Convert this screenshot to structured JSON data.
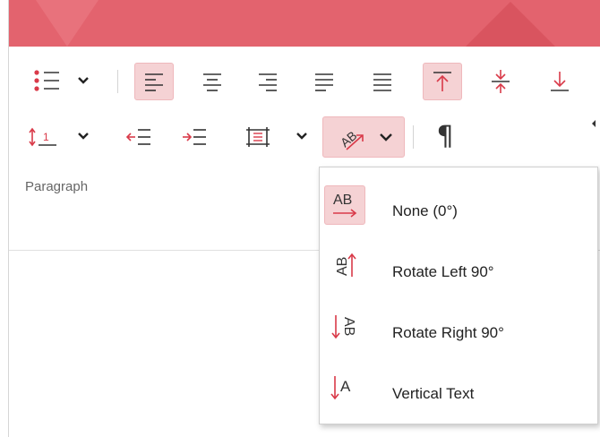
{
  "ribbon": {
    "group_label": "Paragraph",
    "row1": [
      {
        "name": "bullets-icon",
        "active": false
      },
      {
        "name": "chevron-down-icon",
        "active": false
      },
      {
        "name": "align-left-icon",
        "active": true
      },
      {
        "name": "align-center-icon",
        "active": false
      },
      {
        "name": "align-right-icon",
        "active": false
      },
      {
        "name": "justify-icon",
        "active": false
      },
      {
        "name": "distributed-icon",
        "active": false
      },
      {
        "name": "align-top-icon",
        "active": true
      },
      {
        "name": "align-middle-icon",
        "active": false
      },
      {
        "name": "align-bottom-icon",
        "active": false
      }
    ],
    "row2": [
      {
        "name": "line-spacing-icon",
        "active": false
      },
      {
        "name": "chevron-down-icon",
        "active": false
      },
      {
        "name": "decrease-indent-icon",
        "active": false
      },
      {
        "name": "increase-indent-icon",
        "active": false
      },
      {
        "name": "margins-icon",
        "active": false
      },
      {
        "name": "chevron-down-icon",
        "active": false
      },
      {
        "name": "text-direction-icon",
        "active": true
      },
      {
        "name": "pilcrow-icon",
        "active": false
      }
    ],
    "pilcrow_glyph": "¶"
  },
  "text_direction_menu": {
    "items": [
      {
        "label": "None (0°)",
        "icon": "text-direction-none-icon",
        "icon_text": "AB",
        "selected": true
      },
      {
        "label": "Rotate Left 90°",
        "icon": "rotate-left-icon",
        "icon_text": "AB",
        "selected": false
      },
      {
        "label": "Rotate Right 90°",
        "icon": "rotate-right-icon",
        "icon_text": "AB",
        "selected": false
      },
      {
        "label": "Vertical Text",
        "icon": "vertical-text-icon",
        "icon_text": "A",
        "selected": false
      }
    ]
  },
  "colors": {
    "accent": "#e3636e",
    "selection_bg": "#f5d2d4",
    "icon_red": "#d93a49",
    "icon_dark": "#333333"
  }
}
